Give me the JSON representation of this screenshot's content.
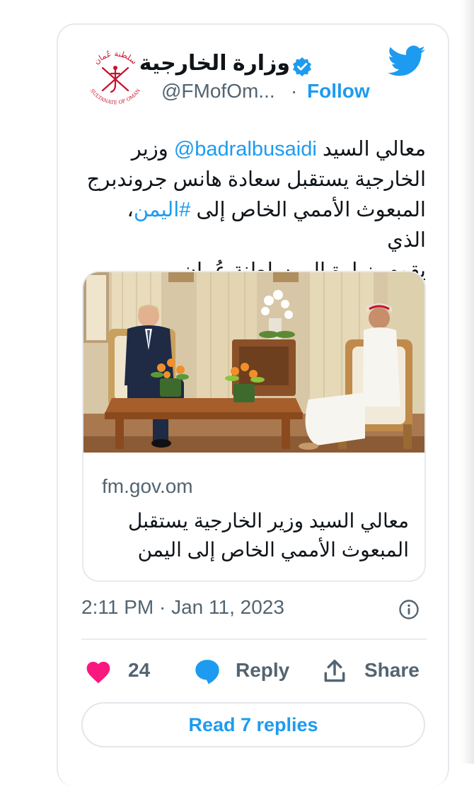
{
  "account": {
    "display_name": "وزارة الخارجية",
    "handle": "@FMofOm...",
    "follow_label": "Follow",
    "separator": "·",
    "avatar_arabic": "سلطنة عُمان",
    "avatar_english": "SULTANATE OF OMAN"
  },
  "tweet": {
    "text_line1_start": "معالي السيد ",
    "mention": "@badralbusaidi",
    "text_line1_end": " وزير",
    "text_line2": "الخارجية يستقبل سعادة هانس جروندبرج",
    "text_line3_start": "المبعوث الأممي الخاص إلى ",
    "hashtag": "#اليمن",
    "text_line3_end": "، الذي",
    "text_line4": "يقوم بزيارة إلى سلطنة عُمان."
  },
  "link_card": {
    "domain": "fm.gov.om",
    "title_line1": "معالي السيد وزير الخارجية يستقبل",
    "title_line2": "المبعوث الأممي الخاص إلى اليمن"
  },
  "meta": {
    "timestamp": "2:11 PM · Jan 11, 2023"
  },
  "actions": {
    "like_count": "24",
    "reply_label": "Reply",
    "share_label": "Share",
    "read_replies_label": "Read 7 replies"
  },
  "colors": {
    "accent": "#1d9bf0",
    "like": "#f91880",
    "muted_text": "#536471",
    "logo_red": "#c8102e"
  }
}
